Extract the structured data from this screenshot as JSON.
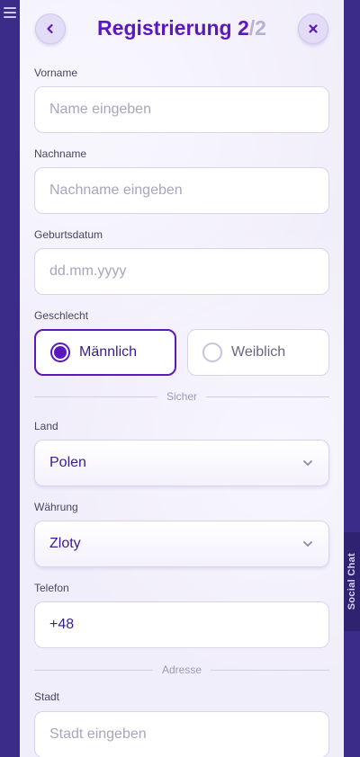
{
  "header": {
    "title": "Registrierung",
    "step_current": "2",
    "step_total": "/2",
    "back_icon": "chevron-left-icon",
    "close_icon": "close-icon"
  },
  "form": {
    "first_name": {
      "label": "Vorname",
      "placeholder": "Name eingeben"
    },
    "last_name": {
      "label": "Nachname",
      "placeholder": "Nachname eingeben"
    },
    "birth_date": {
      "label": "Geburtsdatum",
      "placeholder": "dd.mm.yyyy"
    },
    "gender": {
      "label": "Geschlecht",
      "options": [
        {
          "label": "Männlich",
          "selected": true
        },
        {
          "label": "Weiblich",
          "selected": false
        }
      ]
    },
    "divider_secure": "Sicher",
    "country": {
      "label": "Land",
      "value": "Polen"
    },
    "currency": {
      "label": "Währung",
      "value": "Zloty"
    },
    "phone": {
      "label": "Telefon",
      "value": "+48"
    },
    "divider_address": "Adresse",
    "city": {
      "label": "Stadt",
      "placeholder": "Stadt eingeben"
    }
  },
  "background": {
    "social_chat_tab": "Social Chat"
  },
  "colors": {
    "accent": "#5a18bf",
    "modal_bg": "#f1eefb",
    "page_bg": "#3a2a8c"
  }
}
